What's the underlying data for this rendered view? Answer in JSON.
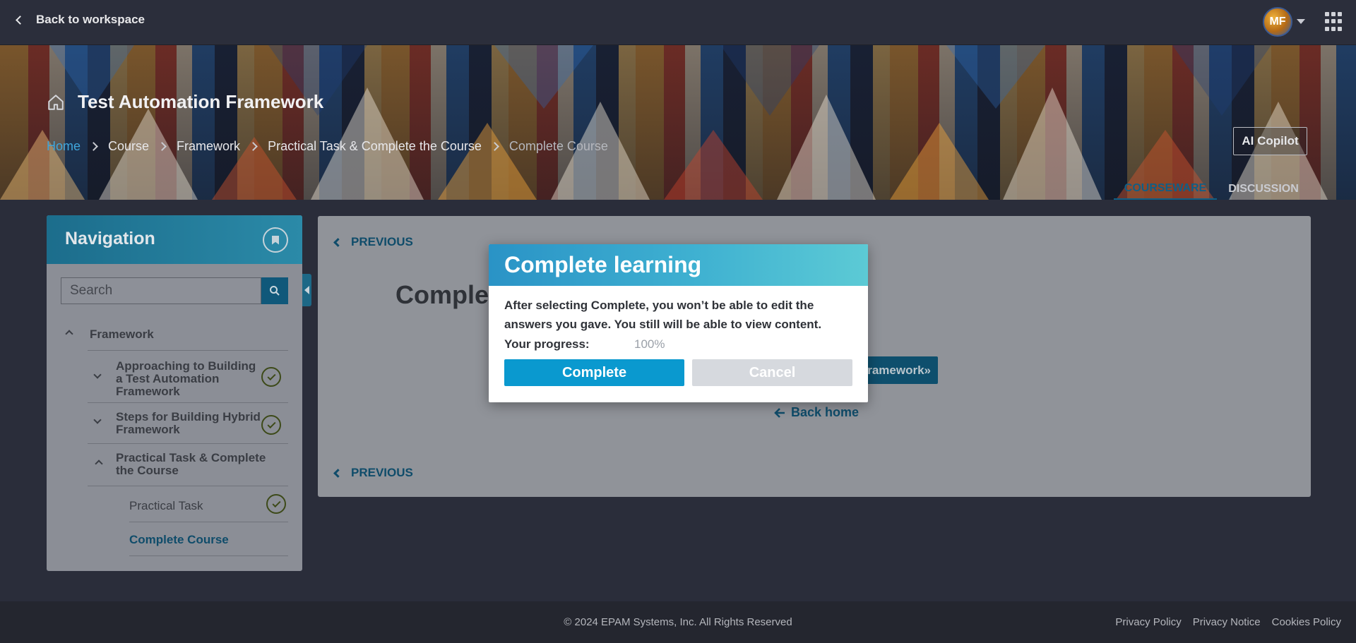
{
  "topbar": {
    "back_label": "Back to workspace",
    "avatar_initials": "MF"
  },
  "hero": {
    "title": "Test Automation Framework",
    "breadcrumb": [
      "Home",
      "Course",
      "Framework",
      "Practical Task & Complete the Course",
      "Complete Course"
    ],
    "ai_copilot_label": "AI Copilot",
    "tabs": [
      {
        "label": "COURSEWARE",
        "active": true
      },
      {
        "label": "DISCUSSION",
        "active": false
      }
    ]
  },
  "navigation": {
    "title": "Navigation",
    "search_placeholder": "Search",
    "tree": {
      "root": "Framework",
      "items": [
        {
          "label": "Approaching to Building a Test Automation Framework",
          "completed": true
        },
        {
          "label": "Steps for Building Hybrid Framework",
          "completed": true
        },
        {
          "label": "Practical Task & Complete the Course",
          "expanded": true,
          "children": [
            {
              "label": "Practical Task",
              "completed": true
            },
            {
              "label": "Complete Course",
              "active": true
            }
          ]
        }
      ]
    }
  },
  "content": {
    "previous_label": "PREVIOUS",
    "heading": "Complet",
    "next_button_label": "ramework»",
    "back_home_label": "Back home"
  },
  "modal": {
    "title": "Complete learning",
    "body": "After selecting Complete, you won’t be able to edit the answers you gave. You still will be able to view content.",
    "progress_label": "Your progress:",
    "progress_value": "100%",
    "complete_label": "Complete",
    "cancel_label": "Cancel"
  },
  "footer": {
    "copyright": "© 2024 EPAM Systems, Inc. All Rights Reserved",
    "links": [
      "Privacy Policy",
      "Privacy Notice",
      "Cookies Policy"
    ]
  },
  "colors": {
    "accent": "#0a99cf",
    "nav_header": "#1c6d8c",
    "completed_check": "#3d4a19"
  }
}
